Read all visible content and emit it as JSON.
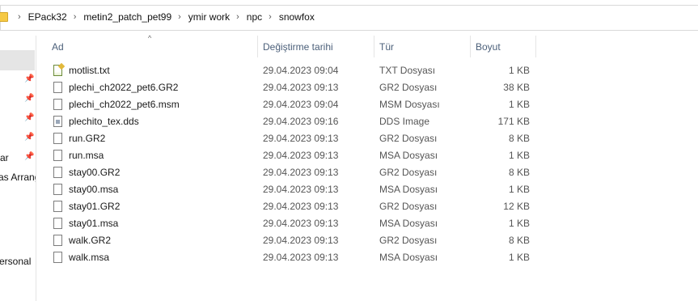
{
  "breadcrumb": [
    "EPack32",
    "metin2_patch_pet99",
    "ymir work",
    "npc",
    "snowfox"
  ],
  "columns": {
    "name": "Ad",
    "date": "Değiştirme tarihi",
    "type": "Tür",
    "size": "Boyut"
  },
  "nav": {
    "items": [
      "ar",
      "as Arrang",
      "ersonal"
    ]
  },
  "files": [
    {
      "name": "motlist.txt",
      "date": "29.04.2023 09:04",
      "type": "TXT Dosyası",
      "size": "1 KB",
      "icon": "text-file-icon"
    },
    {
      "name": "plechi_ch2022_pet6.GR2",
      "date": "29.04.2023 09:13",
      "type": "GR2 Dosyası",
      "size": "38 KB",
      "icon": "file-icon"
    },
    {
      "name": "plechi_ch2022_pet6.msm",
      "date": "29.04.2023 09:04",
      "type": "MSM Dosyası",
      "size": "1 KB",
      "icon": "file-icon"
    },
    {
      "name": "plechito_tex.dds",
      "date": "29.04.2023 09:16",
      "type": "DDS Image",
      "size": "171 KB",
      "icon": "image-file-icon"
    },
    {
      "name": "run.GR2",
      "date": "29.04.2023 09:13",
      "type": "GR2 Dosyası",
      "size": "8 KB",
      "icon": "file-icon"
    },
    {
      "name": "run.msa",
      "date": "29.04.2023 09:13",
      "type": "MSA Dosyası",
      "size": "1 KB",
      "icon": "file-icon"
    },
    {
      "name": "stay00.GR2",
      "date": "29.04.2023 09:13",
      "type": "GR2 Dosyası",
      "size": "8 KB",
      "icon": "file-icon"
    },
    {
      "name": "stay00.msa",
      "date": "29.04.2023 09:13",
      "type": "MSA Dosyası",
      "size": "1 KB",
      "icon": "file-icon"
    },
    {
      "name": "stay01.GR2",
      "date": "29.04.2023 09:13",
      "type": "GR2 Dosyası",
      "size": "12 KB",
      "icon": "file-icon"
    },
    {
      "name": "stay01.msa",
      "date": "29.04.2023 09:13",
      "type": "MSA Dosyası",
      "size": "1 KB",
      "icon": "file-icon"
    },
    {
      "name": "walk.GR2",
      "date": "29.04.2023 09:13",
      "type": "GR2 Dosyası",
      "size": "8 KB",
      "icon": "file-icon"
    },
    {
      "name": "walk.msa",
      "date": "29.04.2023 09:13",
      "type": "MSA Dosyası",
      "size": "1 KB",
      "icon": "file-icon"
    }
  ],
  "colors": {
    "header_text": "#4c607a",
    "folder": "#f6c944",
    "nav_selected": "#e5e5e5"
  }
}
